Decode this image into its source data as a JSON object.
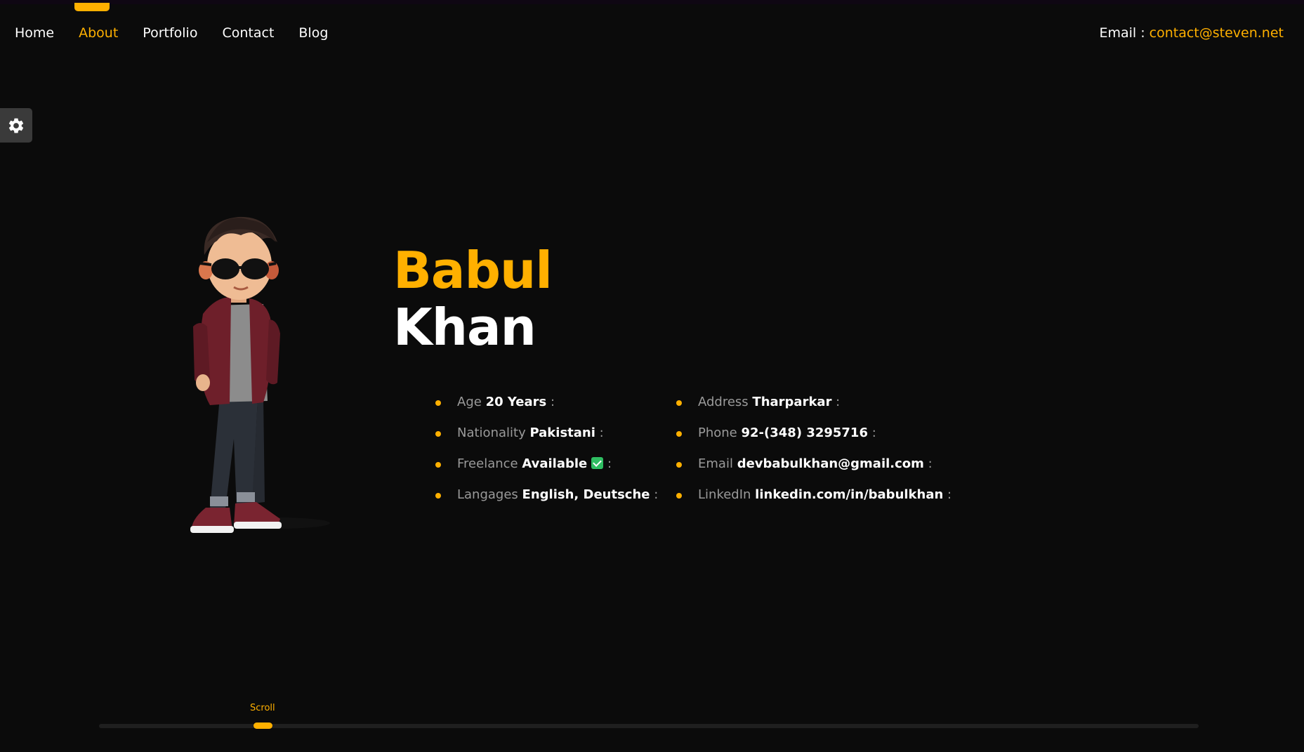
{
  "nav": {
    "items": [
      {
        "label": "Home"
      },
      {
        "label": "About"
      },
      {
        "label": "Portfolio"
      },
      {
        "label": "Contact"
      },
      {
        "label": "Blog"
      }
    ],
    "active": "About"
  },
  "header": {
    "email_label": "Email :",
    "email_value": "contact@steven.net"
  },
  "settings": {
    "icon": "gear-icon"
  },
  "hero": {
    "first_name": "Babul",
    "last_name": "Khan",
    "avatar": "cartoon-boy-avatar"
  },
  "info": {
    "left": [
      {
        "label": "Age",
        "value": "20 Years"
      },
      {
        "label": "Nationality",
        "value": "Pakistani"
      },
      {
        "label": "Freelance",
        "value": "Available"
      },
      {
        "label": "Langages",
        "value": "English, Deutsche"
      }
    ],
    "right": [
      {
        "label": "Address",
        "value": "Tharparkar"
      },
      {
        "label": "Phone",
        "value": "92-(348) 3295716"
      },
      {
        "label": "Email",
        "value": "devbabulkhan@gmail.com"
      },
      {
        "label": "LinkedIn",
        "value": "linkedin.com/in/babulkhan"
      }
    ]
  },
  "scroll": {
    "label": "Scroll",
    "position": 0.15
  },
  "colors": {
    "accent": "#ffb000",
    "background": "#0b0b0b",
    "muted": "#9a9a9a"
  }
}
